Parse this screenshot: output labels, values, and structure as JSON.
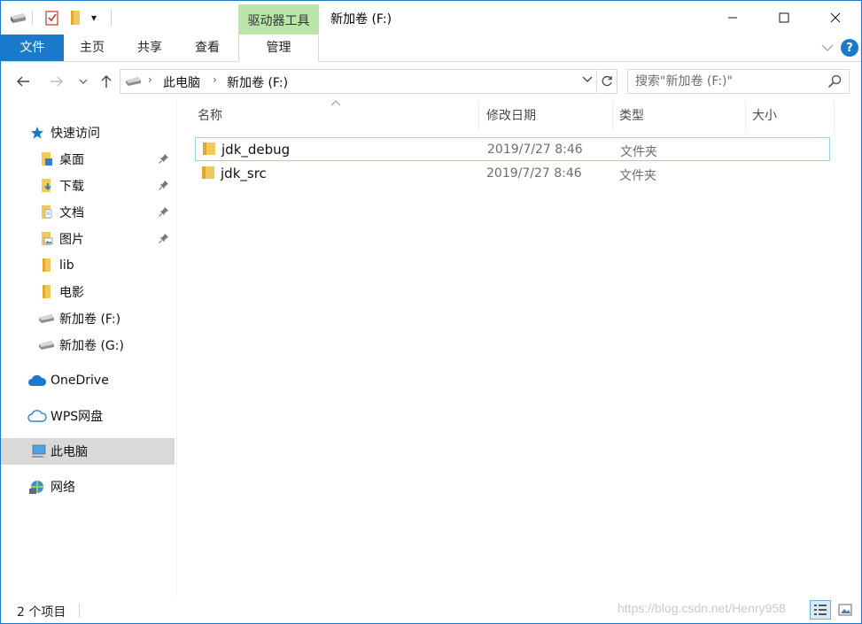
{
  "titlebar": {
    "context_tab": "驱动器工具",
    "title": "新加卷 (F:)",
    "minimize": "—",
    "maximize": "☐",
    "close": "✕",
    "qa_dropdown": "▾"
  },
  "ribbon": {
    "tabs": [
      "文件",
      "主页",
      "共享",
      "查看",
      "管理"
    ],
    "help": "?",
    "expand": "﹀"
  },
  "address": {
    "segments": [
      "此电脑",
      "新加卷 (F:)"
    ],
    "search_placeholder": "搜索\"新加卷 (F:)\""
  },
  "sidebar": {
    "quick_access": "快速访问",
    "items": [
      {
        "label": "桌面",
        "pinned": true
      },
      {
        "label": "下载",
        "pinned": true
      },
      {
        "label": "文档",
        "pinned": true
      },
      {
        "label": "图片",
        "pinned": true
      },
      {
        "label": "lib",
        "pinned": false
      },
      {
        "label": "电影",
        "pinned": false
      },
      {
        "label": "新加卷 (F:)",
        "pinned": false
      },
      {
        "label": "新加卷 (G:)",
        "pinned": false
      }
    ],
    "onedrive": "OneDrive",
    "wps": "WPS网盘",
    "this_pc": "此电脑",
    "network": "网络"
  },
  "columns": {
    "name": "名称",
    "date": "修改日期",
    "type": "类型",
    "size": "大小"
  },
  "files": [
    {
      "name": "jdk_debug",
      "date": "2019/7/27 8:46",
      "type": "文件夹"
    },
    {
      "name": "jdk_src",
      "date": "2019/7/27 8:46",
      "type": "文件夹"
    }
  ],
  "status": {
    "item_count": "2 个项目",
    "watermark": "https://blog.csdn.net/Henry958"
  },
  "colors": {
    "accent": "#1979ca",
    "context_tab": "#b9e6a8",
    "folder": "#f2c75c",
    "selected_nav": "#d9d9d9",
    "hover_border": "#99d1ea"
  }
}
